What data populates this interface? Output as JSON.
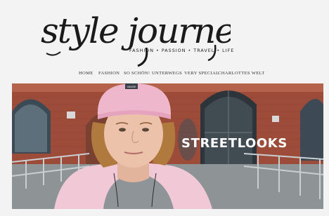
{
  "header": {
    "logo_text": "style journey",
    "tagline": "FASHION • PASSION • TRAVEL • LIFE"
  },
  "nav": {
    "items": [
      {
        "label": "HOME"
      },
      {
        "label": "FASHION"
      },
      {
        "label": "SO SCHÖN!"
      },
      {
        "label": "UNTERWEGS"
      },
      {
        "label": "VERY SPECIAL"
      },
      {
        "label": "CHARLOTTES WELT"
      }
    ]
  },
  "hero": {
    "title": "STREETLOOKS",
    "beanie_label": "VAUDE"
  },
  "colors": {
    "page_bg": "#f3f3f3",
    "brick": "#a04a36",
    "beanie_pink": "#efb7cc",
    "jacket_pink": "#f1c8d6",
    "text_dark": "#222222"
  }
}
